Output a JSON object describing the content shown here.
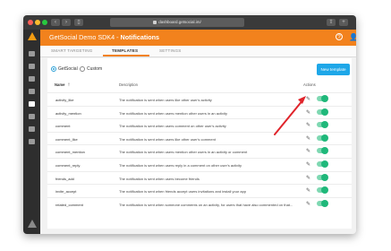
{
  "browser": {
    "url": "dashboard.getsocial.im/"
  },
  "app": {
    "title_prefix": "GetSocial Demo SDK4 - ",
    "title_section": "Notifications"
  },
  "tabs": [
    {
      "label": "SMART TARGETING",
      "active": false
    },
    {
      "label": "TEMPLATES",
      "active": true
    },
    {
      "label": "SETTINGS",
      "active": false
    }
  ],
  "source_options": [
    {
      "label": "GetSocial",
      "selected": true
    },
    {
      "label": "Custom",
      "selected": false
    }
  ],
  "new_template_label": "New template",
  "columns": {
    "name": "Name",
    "description": "Description",
    "actions": "Actions"
  },
  "templates": [
    {
      "name": "activity_like",
      "description": "The notification is sent when users like other user's activity",
      "enabled": true
    },
    {
      "name": "activity_mention",
      "description": "The notification is sent when users mention other users in an activity",
      "enabled": true
    },
    {
      "name": "comment",
      "description": "The notification is sent when users comment on other user's activity",
      "enabled": true
    },
    {
      "name": "comment_like",
      "description": "The notification is sent when users like other user's comment",
      "enabled": true
    },
    {
      "name": "comment_mention",
      "description": "The notification is sent when users mention other users in an activity or comment",
      "enabled": true
    },
    {
      "name": "comment_reply",
      "description": "The notification is sent when users reply in a comment on other user's activity",
      "enabled": true
    },
    {
      "name": "friends_add",
      "description": "The notification is sent when users become friends",
      "enabled": true
    },
    {
      "name": "invite_accept",
      "description": "The notification is sent when friends accept users invitations and install your app",
      "enabled": true
    },
    {
      "name": "related_comment",
      "description": "The notification is sent when someone comments on an activity, for users that have also commented on that...",
      "enabled": true
    }
  ],
  "colors": {
    "brand_orange": "#f2821d",
    "accent_blue": "#1ea7e8",
    "toggle_green": "#1fb87a",
    "annotation_red": "#e0242b"
  }
}
